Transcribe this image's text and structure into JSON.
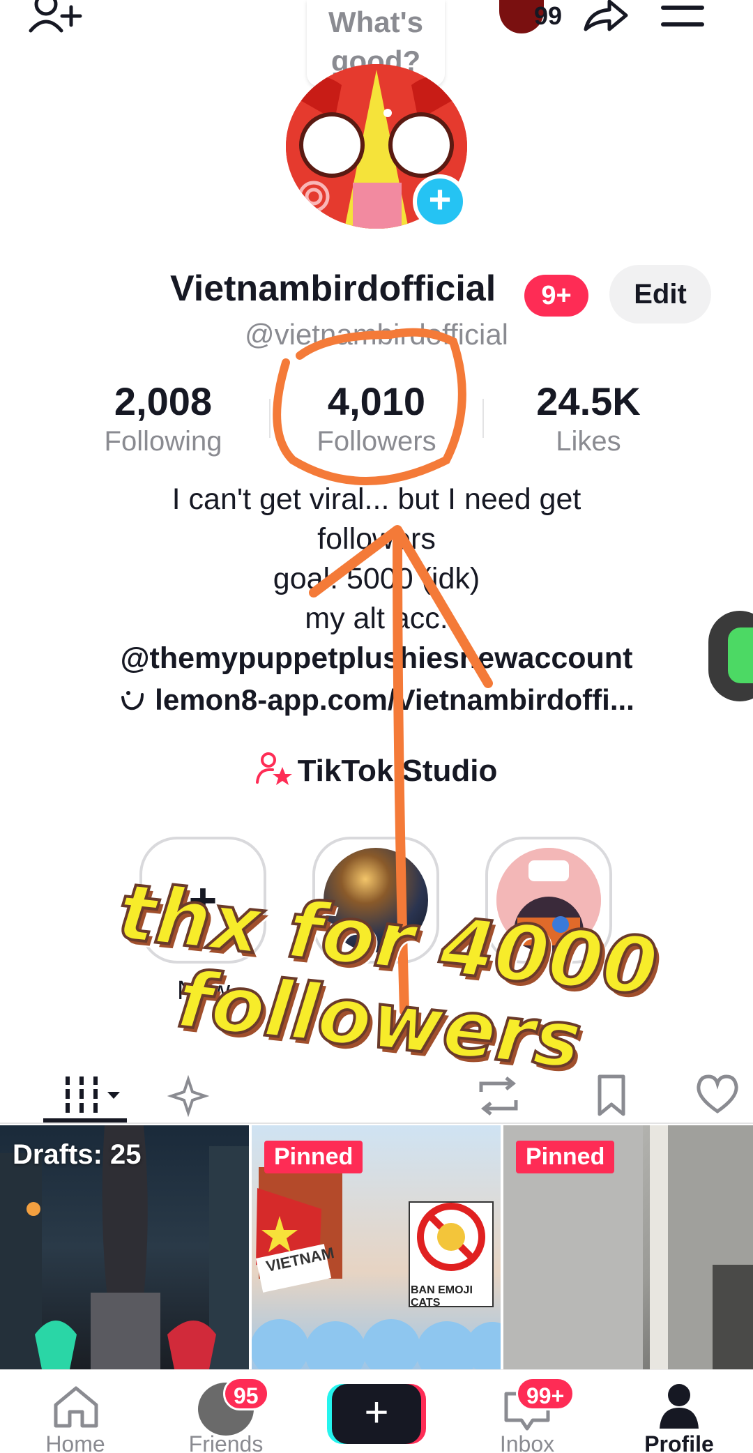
{
  "colors": {
    "accent_red": "#fe2c55",
    "accent_cyan": "#25c3f3",
    "caption_yellow": "#f7ec2a",
    "arrow_orange": "#f47a38",
    "text_primary": "#161823",
    "text_secondary": "#8a8b91"
  },
  "topbar": {
    "add_friend_icon": "add-user-icon",
    "story_bubble": "What's good?",
    "notification_count": "99",
    "share_icon": "share-icon",
    "menu_icon": "menu-icon"
  },
  "profile": {
    "display_name": "Vietnambirdofficial",
    "name_badge": "9+",
    "edit_label": "Edit",
    "handle": "@vietnambirdofficial",
    "stats": [
      {
        "value": "2,008",
        "label": "Following"
      },
      {
        "value": "4,010",
        "label": "Followers"
      },
      {
        "value": "24.5K",
        "label": "Likes"
      }
    ],
    "bio_lines": [
      "I can't get viral... but I need get",
      "followers",
      "goal: 5000 (idk)",
      "my alt acc:"
    ],
    "alt_account": "@themypuppetplushiesnewaccount",
    "link": "lemon8-app.com/Vietnambirdoffi...",
    "studio_label": "TikTok Studio"
  },
  "highlights": [
    {
      "label": "New"
    },
    {
      "label": ""
    },
    {
      "label": ""
    }
  ],
  "tabs": [
    "grid-tab",
    "reposts-tab",
    "private-tab",
    "repost-tab",
    "favorites-tab",
    "liked-tab"
  ],
  "grid": {
    "drafts_label": "Drafts: 25",
    "pinned_label": "Pinned",
    "pinned_label_2": "Pinned",
    "vietnam_sign": "VIETNAM",
    "ban_sign": "BAN EMOJI CATS"
  },
  "overlay": {
    "caption_line1": "thx for 4000",
    "caption_line2": "followers"
  },
  "bottom_nav": {
    "home": "Home",
    "friends": "Friends",
    "friends_badge": "95",
    "inbox": "Inbox",
    "inbox_badge": "99+",
    "profile": "Profile"
  }
}
